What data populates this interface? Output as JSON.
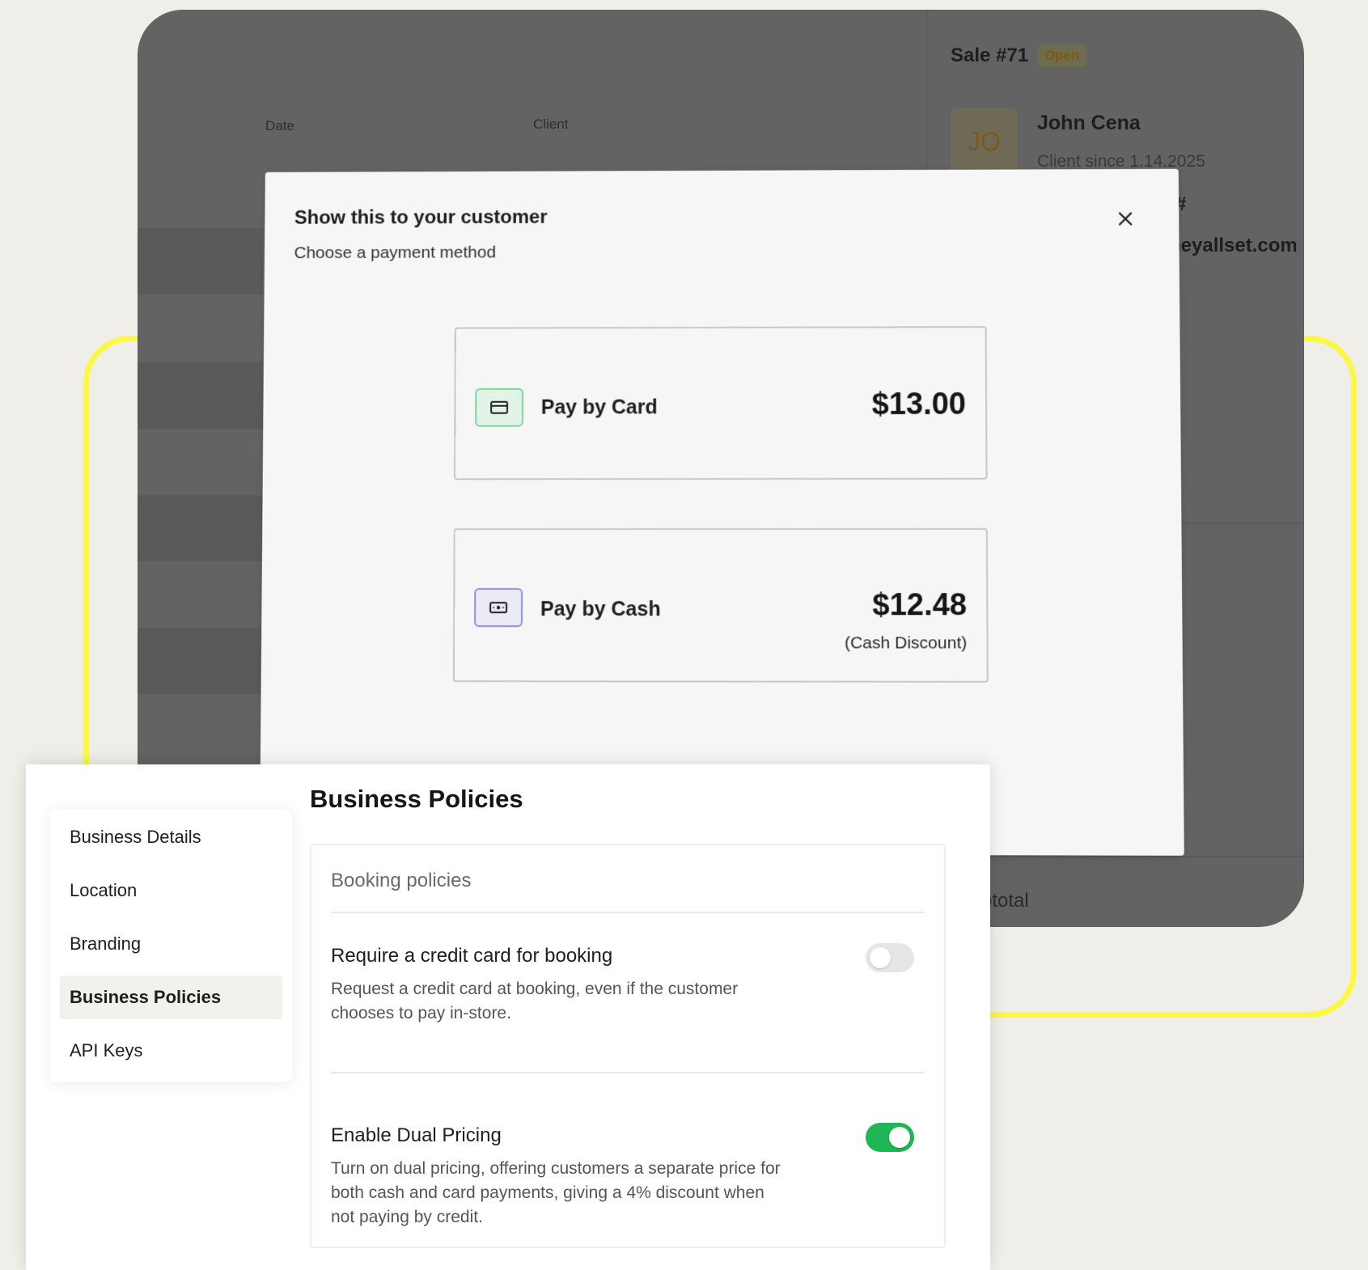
{
  "background_app": {
    "columns": {
      "date": "Date",
      "client": "Client"
    },
    "sale": {
      "title": "Sale #71",
      "status": "Open"
    },
    "client": {
      "initials": "JO",
      "name": "John Cena",
      "since": "Client since 1.14.2025",
      "id_fragment": "#",
      "email_fragment": "heyallset.com"
    },
    "subtotal_fragment": "ototal"
  },
  "payment_modal": {
    "title": "Show this to your customer",
    "subtitle": "Choose a payment method",
    "close_icon": "close-icon",
    "options": [
      {
        "label": "Pay by Card",
        "amount": "$13.00",
        "icon": "credit-card-icon",
        "accent": "#7ed39a"
      },
      {
        "label": "Pay by Cash",
        "amount": "$12.48",
        "note": "(Cash Discount)",
        "icon": "cash-icon",
        "accent": "#8e8fd0"
      }
    ]
  },
  "settings": {
    "title": "Business Policies",
    "nav": [
      {
        "label": "Business Details",
        "active": false
      },
      {
        "label": "Location",
        "active": false
      },
      {
        "label": "Branding",
        "active": false
      },
      {
        "label": "Business Policies",
        "active": true
      },
      {
        "label": "API Keys",
        "active": false
      }
    ],
    "section_title": "Booking policies",
    "policies": [
      {
        "name": "Require a credit card for booking",
        "description": "Request a credit card at booking, even if the customer chooses to pay in-store.",
        "enabled": false
      },
      {
        "name": "Enable Dual Pricing",
        "description": "Turn on dual pricing, offering customers a separate price for both cash and card payments, giving a 4% discount when not paying by credit.",
        "enabled": true
      }
    ]
  },
  "colors": {
    "highlight_frame": "#fbf845",
    "toggle_on": "#1fb655",
    "toggle_off": "#e6e6e6",
    "active_nav_bg": "#f3f1ed"
  }
}
